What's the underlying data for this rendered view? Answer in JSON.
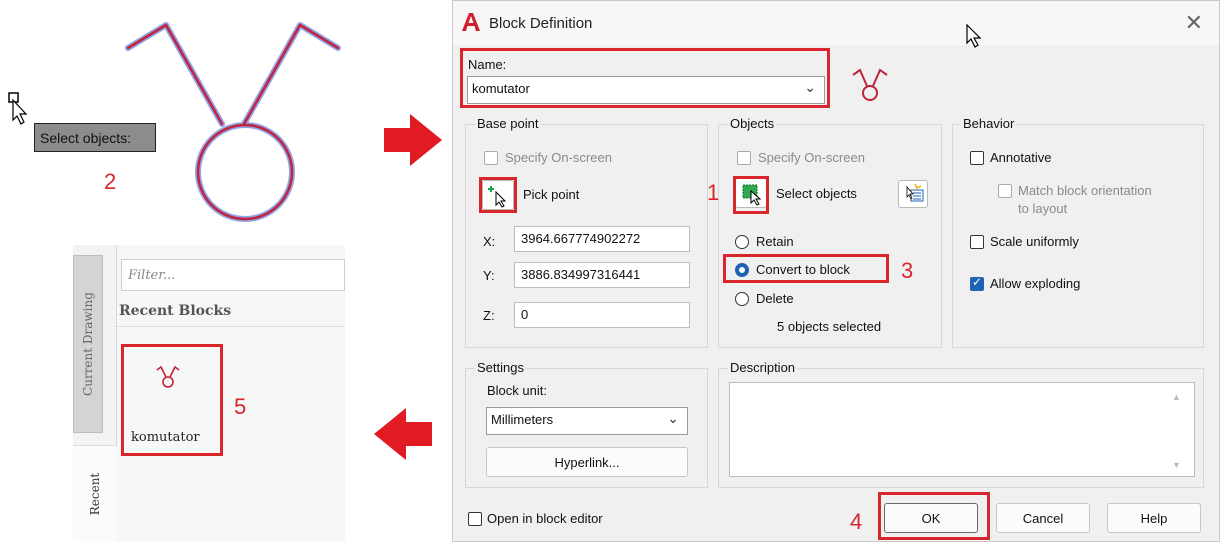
{
  "canvas": {
    "tooltip": "Select objects:",
    "step_2": "2"
  },
  "palette": {
    "filter_placeholder": "Filter...",
    "recent_heading": "Recent Blocks",
    "tab_current": "Current Drawing",
    "tab_recent": "Recent",
    "block_name": "komutator",
    "step_5": "5"
  },
  "dialog": {
    "title": "Block Definition",
    "name_label": "Name:",
    "name_value": "komutator",
    "base_point": {
      "title": "Base point",
      "specify_label": "Specify On-screen",
      "pick_label": "Pick point",
      "x_label": "X:",
      "x_value": "3964.667774902272",
      "y_label": "Y:",
      "y_value": "3886.834997316441",
      "z_label": "Z:",
      "z_value": "0"
    },
    "objects": {
      "title": "Objects",
      "specify_label": "Specify On-screen",
      "select_label": "Select objects",
      "retain_label": "Retain",
      "convert_label": "Convert to block",
      "delete_label": "Delete",
      "count_text": "5 objects selected"
    },
    "behavior": {
      "title": "Behavior",
      "annotative_label": "Annotative",
      "match_label_1": "Match block orientation",
      "match_label_2": "to layout",
      "scale_label": "Scale uniformly",
      "explode_label": "Allow exploding"
    },
    "settings": {
      "title": "Settings",
      "unit_label": "Block unit:",
      "unit_value": "Millimeters",
      "hyperlink_label": "Hyperlink..."
    },
    "description": {
      "title": "Description"
    },
    "open_editor_label": "Open in block editor",
    "ok_label": "OK",
    "cancel_label": "Cancel",
    "help_label": "Help",
    "steps": {
      "s1": "1",
      "s3": "3",
      "s4": "4"
    }
  },
  "colors": {
    "highlight": "#d8262c",
    "accent": "#1e63b5",
    "autocad_red": "#d0202e"
  }
}
